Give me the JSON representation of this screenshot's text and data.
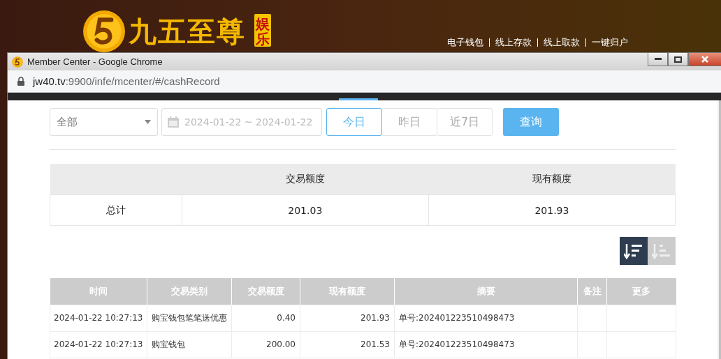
{
  "site_header": {
    "brand": "九五至尊",
    "badge": "娱乐",
    "nav": [
      "电子钱包",
      "线上存款",
      "线上取款",
      "一键归户"
    ]
  },
  "browser": {
    "title": "Member Center - Google Chrome",
    "url_host": "jw40.tv",
    "url_path": ":9900/infe/mcenter/#/cashRecord"
  },
  "filters": {
    "type_select": "全部",
    "date_range": {
      "placeholder": "2024-01-22 ~ 2024-01-22"
    },
    "quick_ranges": [
      {
        "label": "今日",
        "selected": true
      },
      {
        "label": "昨日",
        "selected": false
      },
      {
        "label": "近7日",
        "selected": false
      }
    ],
    "query_button": "查询"
  },
  "summary": {
    "columns": [
      "交易额度",
      "现有额度"
    ],
    "rows": [
      {
        "label": "总计",
        "values": [
          "201.03",
          "201.93"
        ]
      }
    ]
  },
  "sort_buttons": [
    {
      "kind": "desc",
      "selected": true
    },
    {
      "kind": "asc",
      "selected": false
    }
  ],
  "records": {
    "columns": [
      "时间",
      "交易类别",
      "交易额度",
      "现有额度",
      "摘要",
      "备注",
      "更多"
    ],
    "rows": [
      [
        "2024-01-22 10:27:13",
        "购宝钱包笔笔送优惠",
        "0.40",
        "201.93",
        "单号:202401223510498473"
      ],
      [
        "2024-01-22 10:27:13",
        "购宝钱包",
        "200.00",
        "201.53",
        "单号:202401223510498473"
      ]
    ]
  }
}
